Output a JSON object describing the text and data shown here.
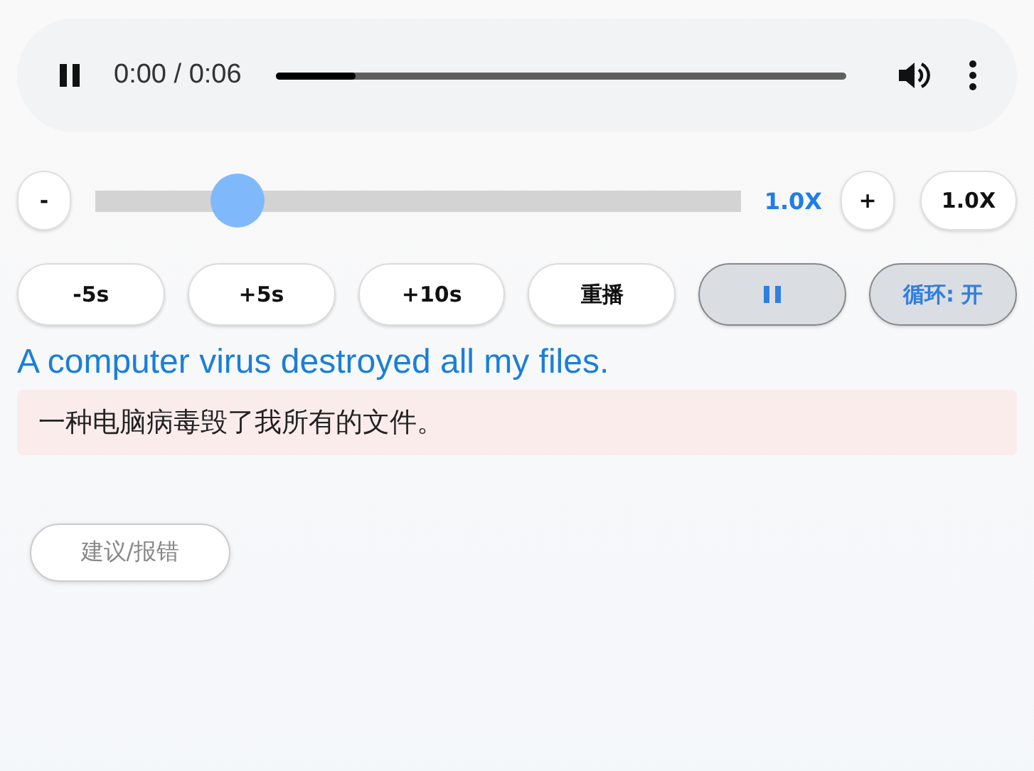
{
  "player": {
    "playing": true,
    "time": "0:00 / 0:06",
    "level": 0.14
  },
  "speed": {
    "minus": "-",
    "level": 0.22,
    "reading": "1.0X",
    "plus": "+",
    "reset": "1.0X"
  },
  "controls": [
    {
      "kind": "text",
      "label": "-5s",
      "selected": false
    },
    {
      "kind": "text",
      "label": "+5s",
      "selected": false
    },
    {
      "kind": "text",
      "label": "+10s",
      "selected": false
    },
    {
      "kind": "text",
      "label": "重播",
      "selected": false
    },
    {
      "kind": "pause",
      "selected": true
    },
    {
      "kind": "text",
      "label": "循环: 开",
      "selected": true
    }
  ],
  "sentence": "A computer virus destroyed all my files.",
  "translation": "一种电脑病毒毁了我所有的文件。",
  "feedback": "建议/报错"
}
